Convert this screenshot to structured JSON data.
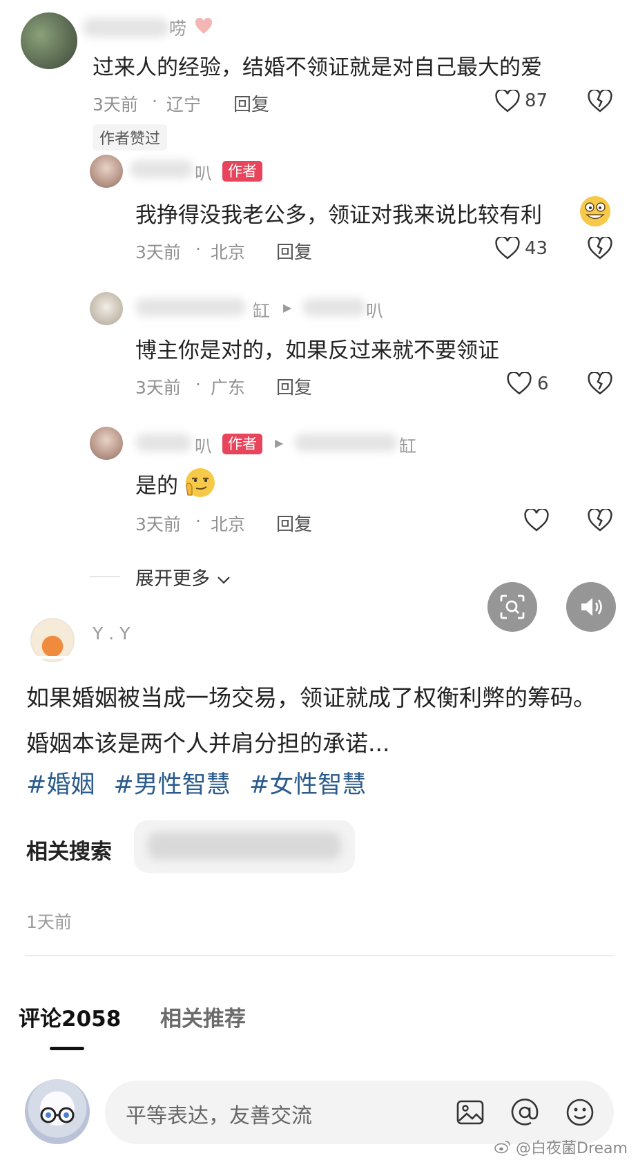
{
  "comments": [
    {
      "name_suffix": "唠",
      "text": "过来人的经验，结婚不领证就是对自己最大的爱",
      "time": "3天前",
      "location": "辽宁",
      "reply": "回复",
      "likes": "87",
      "author_liked": "作者赞过"
    },
    {
      "name_suffix": "叭",
      "author_badge": "作者",
      "text": "我挣得没我老公多，领证对我来说比较有利",
      "time": "3天前",
      "location": "北京",
      "reply": "回复",
      "likes": "43"
    },
    {
      "name_suffix": "缸",
      "target_suffix": "叭",
      "text": "博主你是对的，如果反过来就不要领证",
      "time": "3天前",
      "location": "广东",
      "reply": "回复",
      "likes": "6"
    },
    {
      "name_suffix": "叭",
      "author_badge": "作者",
      "target_suffix": "缸",
      "text": "是的",
      "time": "3天前",
      "location": "北京",
      "reply": "回复",
      "likes": ""
    }
  ],
  "expand_more": "展开更多",
  "post": {
    "author": "Y . Y",
    "body": "如果婚姻被当成一场交易，领证就成了权衡利弊的筹码。婚姻本该是两个人并肩分担的承诺...",
    "hashtags": [
      "#婚姻",
      "#男性智慧",
      "#女性智慧"
    ],
    "related_search_label": "相关搜索",
    "time": "1天前"
  },
  "tabs": [
    {
      "label": "评论2058",
      "active": true
    },
    {
      "label": "相关推荐",
      "active": false
    }
  ],
  "input": {
    "placeholder": "平等表达，友善交流"
  },
  "watermark": "@白夜菌Dream",
  "colors": {
    "badge": "#e8455c",
    "hashtag": "#2a5b8c",
    "fab": "#787878"
  }
}
